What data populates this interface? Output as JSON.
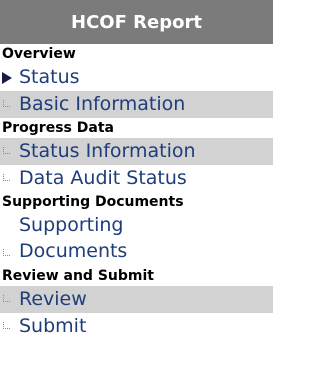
{
  "header": {
    "title": "HCOF Report"
  },
  "sections": [
    {
      "heading": "Overview",
      "items": [
        {
          "label": "Status",
          "current": true,
          "shaded": false
        },
        {
          "label": "Basic Information",
          "current": false,
          "shaded": true
        }
      ]
    },
    {
      "heading": "Progress Data",
      "items": [
        {
          "label": "Status Information",
          "current": false,
          "shaded": true
        },
        {
          "label": "Data Audit Status",
          "current": false,
          "shaded": false
        }
      ]
    },
    {
      "heading": "Supporting Documents",
      "items": [
        {
          "label": "Supporting Documents",
          "current": false,
          "shaded": false,
          "multiline": true
        }
      ]
    },
    {
      "heading": "Review and Submit",
      "items": [
        {
          "label": "Review",
          "current": false,
          "shaded": true
        },
        {
          "label": "Submit",
          "current": false,
          "shaded": false
        }
      ]
    }
  ],
  "colors": {
    "header_bg": "#7b7b7b",
    "link": "#1f3d7a",
    "shade": "#d2d2d2"
  },
  "icons": {
    "current": "current-page-arrow-icon",
    "other": "tree-dots-icon"
  }
}
